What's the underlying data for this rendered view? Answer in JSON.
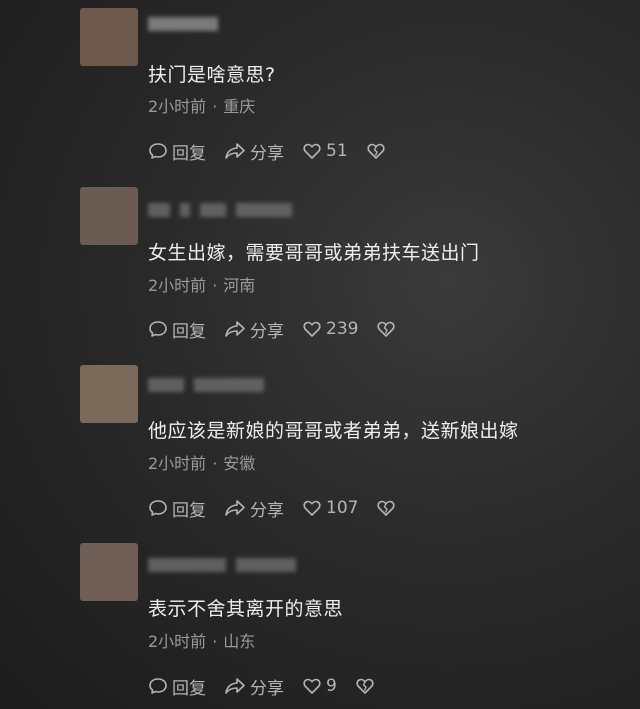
{
  "comments": [
    {
      "text": "扶门是啥意思?",
      "time": "2小时前",
      "location": "重庆",
      "reply_label": "回复",
      "share_label": "分享",
      "likes": "51"
    },
    {
      "text": "女生出嫁，需要哥哥或弟弟扶车送出门",
      "time": "2小时前",
      "location": "河南",
      "reply_label": "回复",
      "share_label": "分享",
      "likes": "239"
    },
    {
      "text": "他应该是新娘的哥哥或者弟弟，送新娘出嫁",
      "time": "2小时前",
      "location": "安徽",
      "reply_label": "回复",
      "share_label": "分享",
      "likes": "107"
    },
    {
      "text": "表示不舍其离开的意思",
      "time": "2小时前",
      "location": "山东",
      "reply_label": "回复",
      "share_label": "分享",
      "likes": "9"
    }
  ],
  "meta_separator": "·",
  "icons": {
    "reply": "chat-bubble-icon",
    "share": "share-arrow-icon",
    "like": "heart-icon",
    "dislike": "broken-heart-icon"
  },
  "colors": {
    "background": "#2a2a2a",
    "text": "#eeeeee",
    "meta": "#9a9a9a",
    "action": "#b5b5b5"
  }
}
